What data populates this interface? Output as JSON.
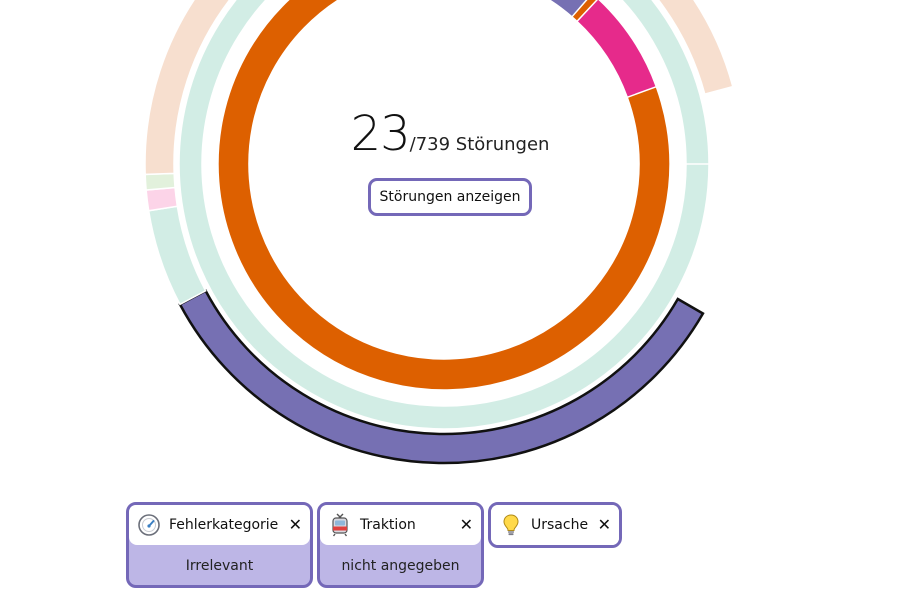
{
  "center": {
    "count": "23",
    "total_text": "/739 Störungen",
    "button_label": "Störungen anzeigen"
  },
  "filters": [
    {
      "title": "Fehlerkategorie",
      "icon": "gauge-icon",
      "value": "Irrelevant",
      "close": "✕"
    },
    {
      "title": "Traktion",
      "icon": "tram-icon",
      "value": "nicht angegeben",
      "close": "✕"
    },
    {
      "title": "Ursache",
      "icon": "lightbulb-icon",
      "value": "",
      "close": "✕"
    }
  ],
  "colors": {
    "accent": "#7468b8",
    "chip_fill": "#bdb6e6",
    "ring_orange": "#dd6000",
    "ring_green": "#1a9e74",
    "ring_purple": "#7670b3",
    "ring_pink": "#e62a8b",
    "ring_mint": "#d2ede5",
    "ring_peach": "#f7dfcf",
    "ring_light_green": "#e2f1dc",
    "ring_light_pink": "#fcd4e8"
  },
  "rings": {
    "inner": [
      {
        "name": "orange",
        "color": "#dd6000",
        "start": -108,
        "end": 270
      },
      {
        "name": "green",
        "color": "#1a9e74",
        "start": 270,
        "end": 294
      },
      {
        "name": "purple",
        "color": "#7670b3",
        "start": 295,
        "end": 311
      },
      {
        "name": "pink",
        "color": "#e62a8b",
        "start": 313,
        "end": 340
      }
    ],
    "middle": [
      {
        "name": "mint",
        "color": "#d2ede5",
        "start": 0,
        "end": 360
      }
    ],
    "outer": [
      {
        "name": "purple-selected",
        "color": "#7670b3",
        "start": 30,
        "end": 152,
        "selected": true
      },
      {
        "name": "mint",
        "color": "#d2ede5",
        "start": 152,
        "end": 171
      },
      {
        "name": "light-pink",
        "color": "#fcd4e8",
        "start": 171,
        "end": 175
      },
      {
        "name": "light-green",
        "color": "#e2f1dc",
        "start": 175,
        "end": 178
      },
      {
        "name": "peach",
        "color": "#f7dfcf",
        "start": 178,
        "end": 345
      }
    ]
  }
}
